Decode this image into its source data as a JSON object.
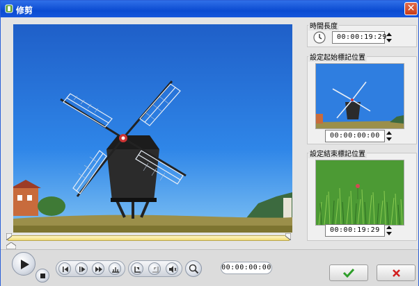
{
  "window": {
    "title": "修剪",
    "close_symbol": "✕"
  },
  "panels": {
    "duration": {
      "label": "時間長度",
      "value": "00:00:19:29"
    },
    "mark_in": {
      "label": "設定起始標記位置",
      "value": "00:00:00:00"
    },
    "mark_out": {
      "label": "設定結束標記位置",
      "value": "00:00:19:29"
    }
  },
  "status": {
    "current_time": "00:00:00:00"
  },
  "icons": {
    "clock": "clock-icon",
    "play": "play-icon",
    "stop": "stop-icon",
    "prev_frame": "previous-frame-icon",
    "next_frame": "next-frame-icon",
    "fast_forward": "fast-forward-icon",
    "marker": "marker-icon",
    "mark_in": "mark-in-icon",
    "mark_out": "mark-out-icon",
    "audio": "audio-icon",
    "zoom": "zoom-icon",
    "ok": "check-icon",
    "cancel": "x-icon"
  },
  "colors": {
    "ok": "#2e9e2a",
    "cancel": "#d21e1e",
    "title_bar": "#0b4bd1",
    "trim_bar": "#f2dc74"
  }
}
